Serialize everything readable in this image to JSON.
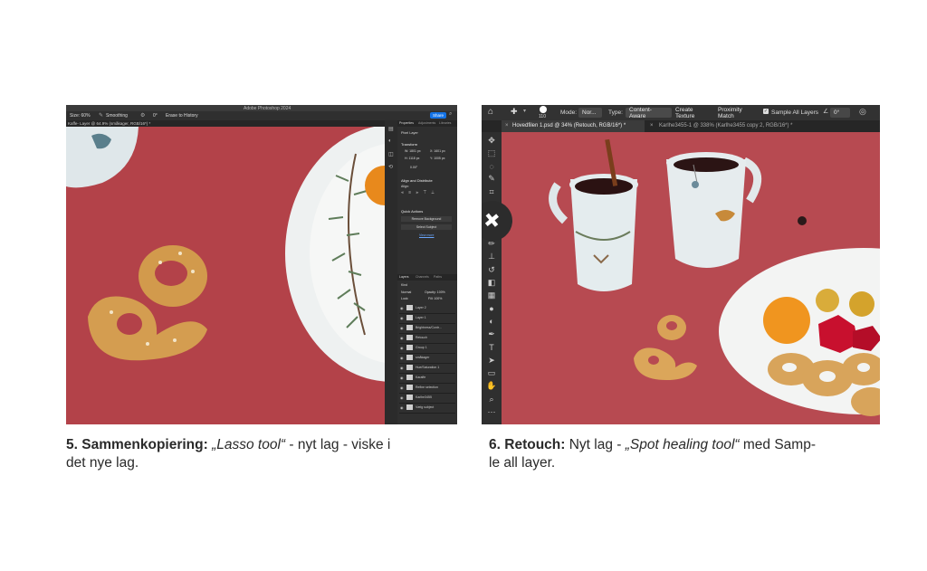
{
  "left_screenshot": {
    "app_title": "Adobe Photoshop 2024",
    "options": {
      "size": "Size: 60%",
      "mode": "Smoothing",
      "angle": "0°",
      "sample_label": "Erase to History",
      "share": "Share"
    },
    "doc_tab": "Kaffe- Layer @ 64.9% (småkager, RGB/16*) *",
    "properties_panel": {
      "tabs": [
        "Properties",
        "Adjustments",
        "Libraries"
      ],
      "pixel_layer": "Pixel Layer",
      "transform_title": "Transform",
      "w": "W: 1801 px",
      "x": "X: 1601 px",
      "h": "H: 1118 px",
      "y": "Y: 1005 px",
      "angle": "0.00°",
      "align_title": "Align and Distribute",
      "align_label": "Align:",
      "quick_title": "Quick Actions",
      "qa_buttons": [
        "Remove Background",
        "Select Subject"
      ],
      "view_more": "View more"
    },
    "layers_panel": {
      "tabs": [
        "Layers",
        "Channels",
        "Paths"
      ],
      "kind": "Kind",
      "blend": "Normal",
      "opacity": "Opacity: 100%",
      "lock": "Lock:",
      "fill": "Fill: 100%",
      "layers": [
        "Layer 2",
        "Layer 1",
        "Brightness/Contr...",
        "Retouch",
        "Group 1",
        "småkager",
        "Hue/Saturation 1",
        "Karaffe",
        "Refine selection",
        "Karlhe3455",
        "Vælg subject"
      ]
    }
  },
  "right_screenshot": {
    "options": {
      "brush_size": "110",
      "mode_label": "Mode:",
      "mode_value": "Nor...",
      "type_label": "Type:",
      "type_buttons": [
        "Content-Aware",
        "Create Texture",
        "Proximity Match"
      ],
      "sample_all": "Sample All Layers",
      "angle": "0°"
    },
    "tabs": [
      {
        "label": "Hovedfilen 1.psd @ 34% (Retouch, RGB/16*) *",
        "active": true
      },
      {
        "label": "Karlhe3455-1 @ 338% (Karlhe3455 copy 2, RGB/16*) *",
        "active": false
      }
    ],
    "tools": [
      "move-icon",
      "marquee-icon",
      "lasso-icon",
      "quick-select-icon",
      "crop-icon",
      "frame-icon",
      "eyedropper-icon",
      "healing-icon",
      "brush-icon",
      "stamp-icon",
      "history-brush-icon",
      "eraser-icon",
      "gradient-icon",
      "blur-icon",
      "dodge-icon",
      "pen-icon",
      "type-icon",
      "path-select-icon",
      "rectangle-icon",
      "hand-icon",
      "zoom-icon",
      "more-icon"
    ]
  },
  "captions": {
    "left": {
      "number": "5.",
      "title": "Sammenkopiering:",
      "italic": "„Lasso tool“",
      "rest_line1": " - nyt lag - viske i",
      "line2": "det nye lag."
    },
    "right": {
      "number": "6.",
      "title": "Retouch:",
      "prefix": " Nyt lag - ",
      "italic": "„Spot healing tool“",
      "rest_line1": " med Samp-",
      "line2": "le all layer."
    }
  },
  "colors": {
    "tablecloth_left": "#b34249",
    "tablecloth_right": "#b74a51",
    "ps_panel": "#2f2f2f",
    "ps_accent": "#1473e6"
  }
}
